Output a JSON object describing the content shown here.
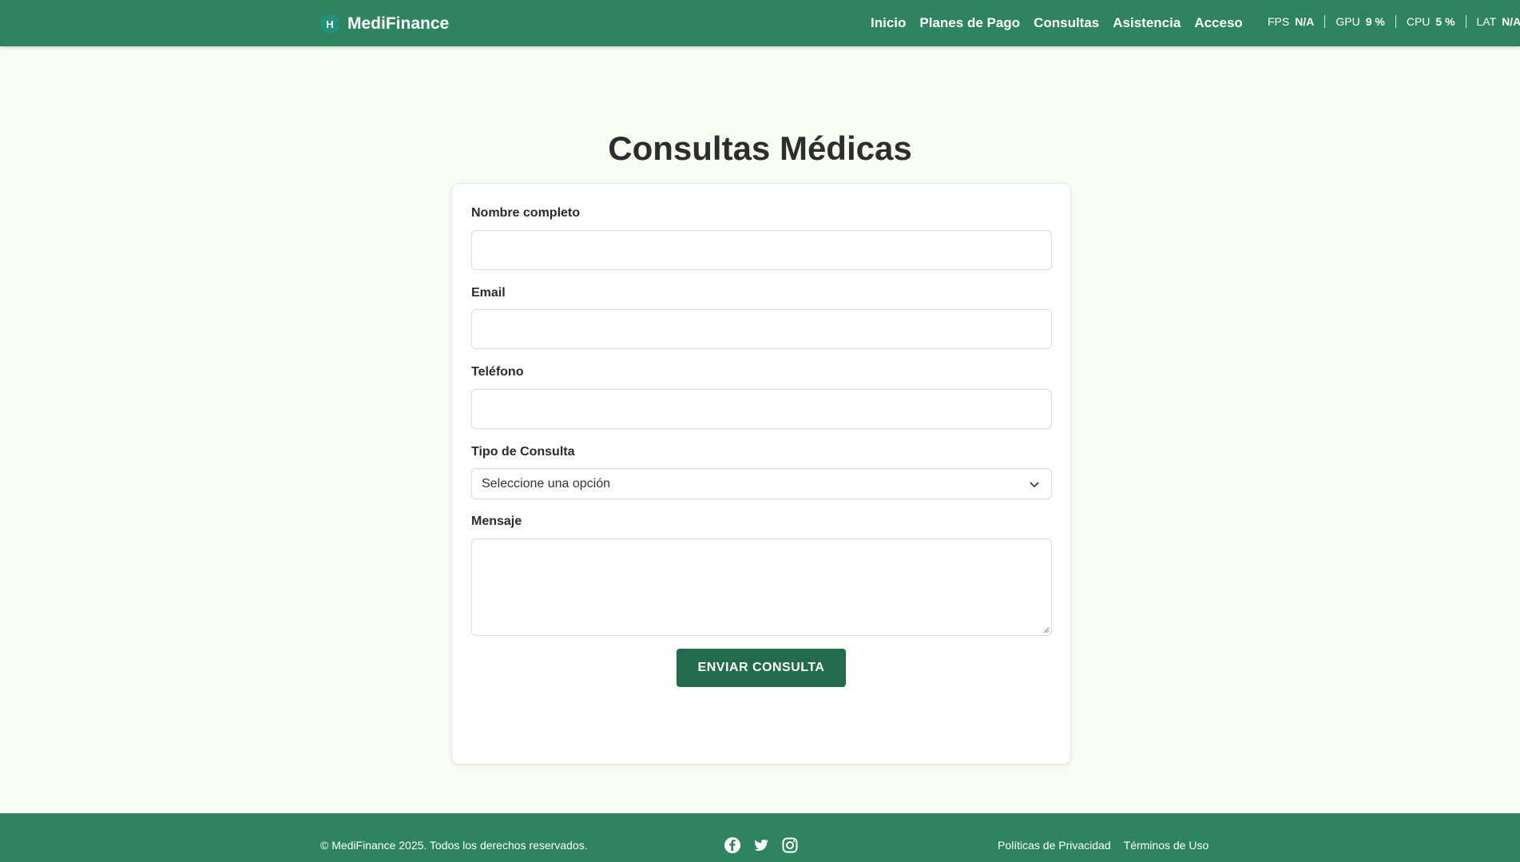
{
  "header": {
    "brand_badge": "H",
    "brand": "MediFinance",
    "nav": [
      "Inicio",
      "Planes de Pago",
      "Consultas",
      "Asistencia",
      "Acceso"
    ],
    "metrics": [
      {
        "label": "FPS",
        "value": "N/A"
      },
      {
        "label": "GPU",
        "value": "9 %"
      },
      {
        "label": "CPU",
        "value": "5 %"
      },
      {
        "label": "LAT",
        "value": "N/A"
      }
    ]
  },
  "main": {
    "title": "Consultas Médicas",
    "form": {
      "name_label": "Nombre completo",
      "name_value": "",
      "email_label": "Email",
      "email_value": "",
      "phone_label": "Teléfono",
      "phone_value": "",
      "type_label": "Tipo de Consulta",
      "type_selected": "Seleccione una opción",
      "message_label": "Mensaje",
      "message_value": "",
      "submit_label": "ENVIAR CONSULTA"
    }
  },
  "footer": {
    "copyright": "© MediFinance 2025. Todos los derechos reservados.",
    "socials": [
      "facebook-icon",
      "twitter-icon",
      "instagram-icon"
    ],
    "links": [
      "Políticas de Privacidad",
      "Términos de Uso"
    ]
  },
  "colors": {
    "header_bg": "#2e8460",
    "page_bg": "#f9fdf3",
    "button_bg": "#236b4f"
  }
}
